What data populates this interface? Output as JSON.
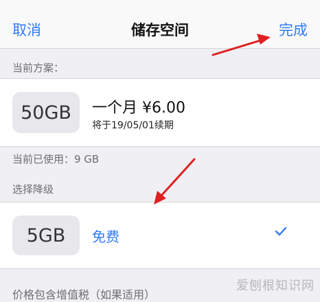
{
  "navbar": {
    "cancel_label": "取消",
    "title": "储存空间",
    "done_label": "完成"
  },
  "current_plan": {
    "section_header": "当前方案：",
    "storage": "50GB",
    "price": "一个月 ¥6.00",
    "renewal": "将于19/05/01续期"
  },
  "usage": {
    "text": "当前已使用：9 GB"
  },
  "downgrade": {
    "section_header": "选择降级",
    "options": [
      {
        "storage": "5GB",
        "price": "免费",
        "selected": true
      }
    ]
  },
  "footer": {
    "text": "价格包含增值税（如果适用）"
  },
  "watermark": {
    "text": "爱刨根知识网"
  },
  "colors": {
    "accent": "#2f7cf6",
    "annotation_arrow": "#e02020",
    "background": "#efeff4"
  },
  "icons": {
    "selected": "checkmark-icon"
  }
}
